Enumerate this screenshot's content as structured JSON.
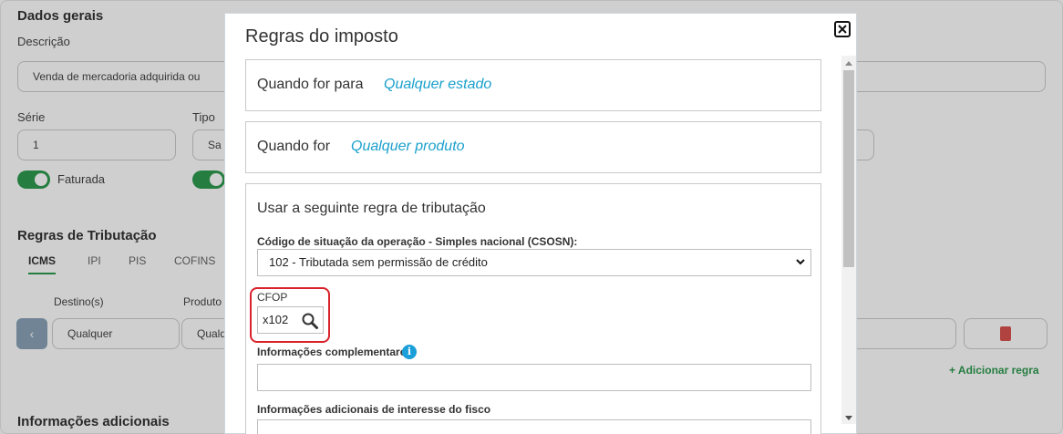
{
  "background": {
    "section_title": "Dados gerais",
    "descricao_label": "Descrição",
    "descricao_value": "Venda de mercadoria adquirida ou",
    "serie_label": "Série",
    "serie_value": "1",
    "tipo_label": "Tipo",
    "tipo_value": "Sa",
    "faturada_label": "Faturada",
    "regras_title": "Regras de Tributação",
    "tabs": [
      "ICMS",
      "IPI",
      "PIS",
      "COFINS"
    ],
    "destino_label": "Destino(s)",
    "produto_label": "Produto",
    "destino_value": "Qualquer",
    "produto_value": "Qualq",
    "row_button": "‹",
    "add_rule_label": "+ Adicionar regra",
    "info_title": "Informações adicionais"
  },
  "modal": {
    "title": "Regras do imposto",
    "card_destino": {
      "label": "Quando for para",
      "link": "Qualquer estado"
    },
    "card_produto": {
      "label": "Quando for",
      "link": "Qualquer produto"
    },
    "card_regra": {
      "title": "Usar a seguinte regra de tributação",
      "csosn_label": "Código de situação da operação - Simples nacional (CSOSN):",
      "csosn_value": "102 - Tributada sem permissão de crédito",
      "cfop_label": "CFOP",
      "cfop_value": "x102",
      "info_compl_label": "Informações complementares",
      "info_icon_glyph": "i",
      "info_fisco_label": "Informações adicionais de interesse do fisco"
    }
  },
  "colors": {
    "accent_link": "#1aa0cc",
    "highlight_border": "#d9222a",
    "toggle_green": "#2e9b4f",
    "info_blue": "#1a9fd8"
  },
  "icons": [
    "close-icon",
    "chevron-down-icon",
    "magnifier-icon",
    "info-icon",
    "trash-icon"
  ]
}
